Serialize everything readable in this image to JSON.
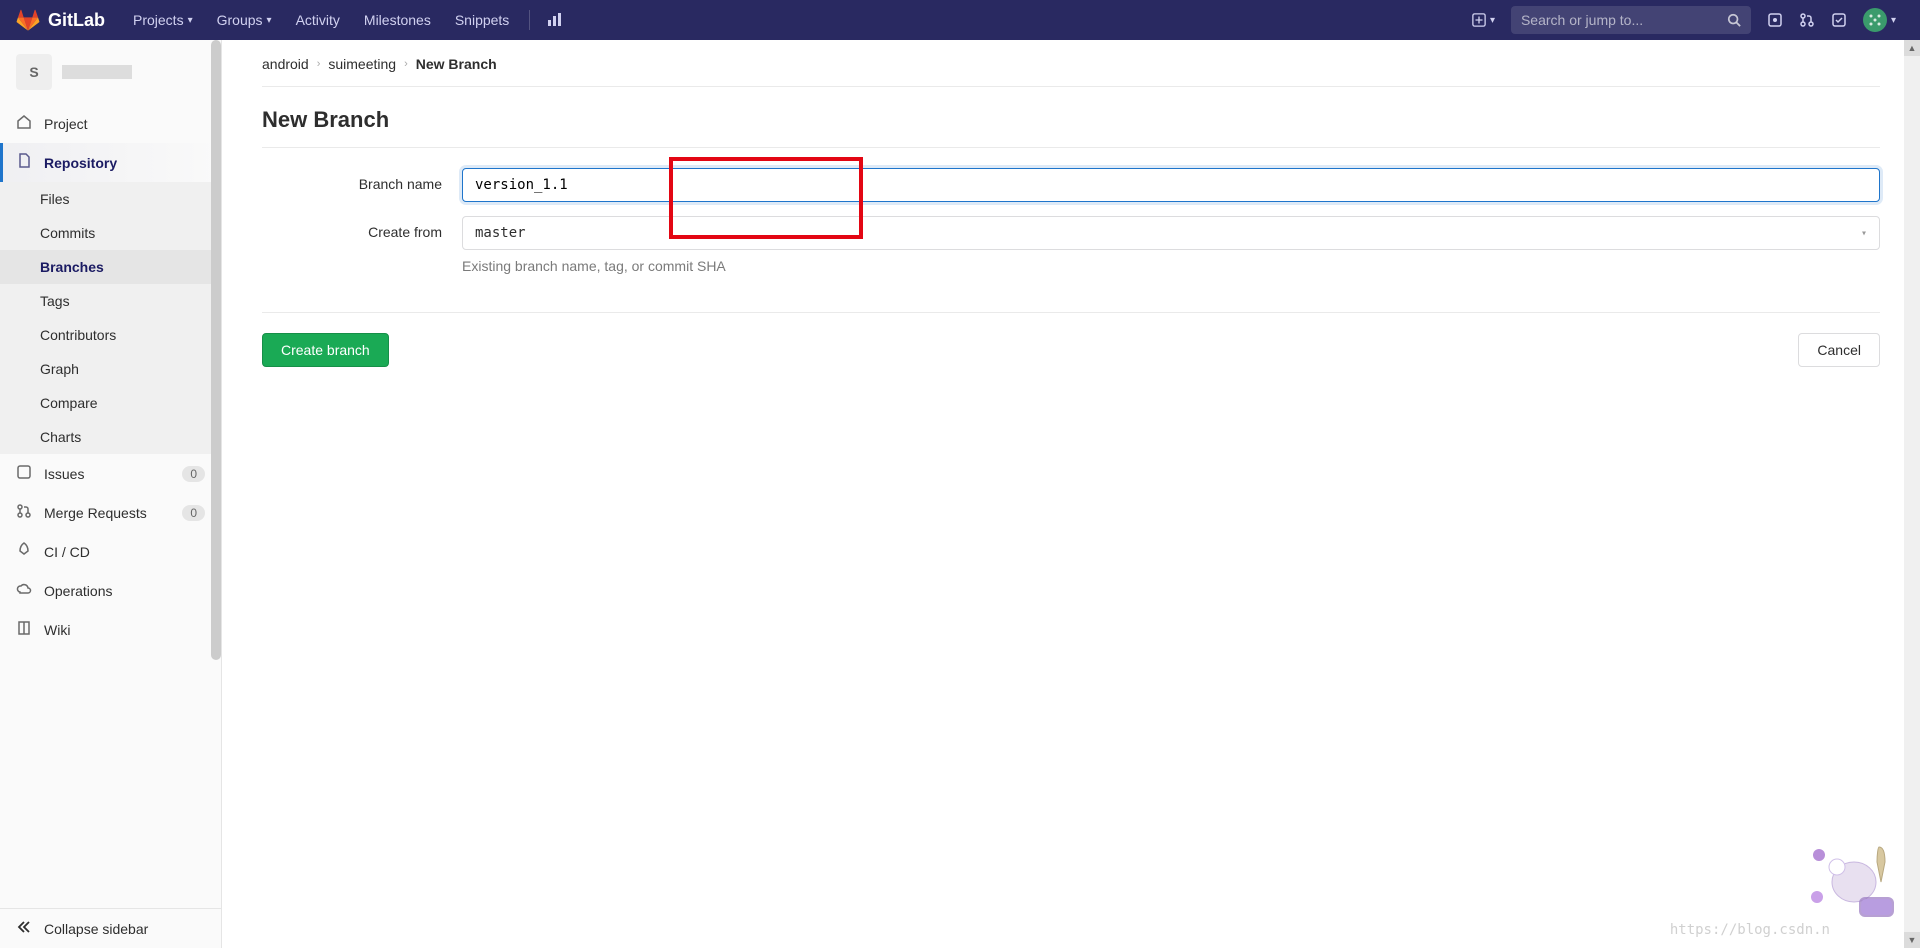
{
  "topnav": {
    "brand": "GitLab",
    "links": [
      "Projects",
      "Groups",
      "Activity",
      "Milestones",
      "Snippets"
    ],
    "search_placeholder": "Search or jump to..."
  },
  "sidebar": {
    "project_letter": "S",
    "items": {
      "project": "Project",
      "repository": "Repository",
      "repo_sub": [
        "Files",
        "Commits",
        "Branches",
        "Tags",
        "Contributors",
        "Graph",
        "Compare",
        "Charts"
      ],
      "issues": "Issues",
      "issues_count": "0",
      "mr": "Merge Requests",
      "mr_count": "0",
      "cicd": "CI / CD",
      "operations": "Operations",
      "wiki": "Wiki",
      "collapse": "Collapse sidebar"
    }
  },
  "breadcrumbs": {
    "a": "android",
    "b": "suimeeting",
    "c": "New Branch"
  },
  "page": {
    "title": "New Branch",
    "label_branch": "Branch name",
    "input_value": "version_1.1",
    "label_create_from": "Create from",
    "create_from_value": "master",
    "help": "Existing branch name, tag, or commit SHA",
    "create_btn": "Create branch",
    "cancel_btn": "Cancel"
  },
  "watermark": "https://blog.csdn.n"
}
